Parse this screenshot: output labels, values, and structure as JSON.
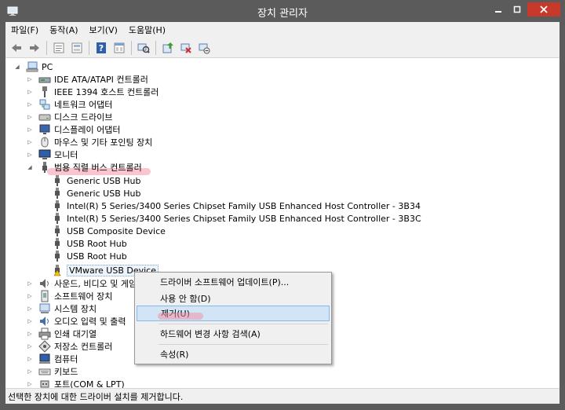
{
  "window": {
    "title": "장치 관리자",
    "accent_color": "#c7392b"
  },
  "menu": {
    "file": "파일(F)",
    "action": "동작(A)",
    "view": "보기(V)",
    "help": "도움말(H)"
  },
  "toolbar": {
    "buttons": [
      "back-arrow-icon",
      "forward-arrow-icon",
      "properties-icon",
      "show-hide-icon",
      "help-icon",
      "view-icon",
      "scan-hardware-icon",
      "update-driver-icon",
      "uninstall-icon",
      "disable-icon"
    ]
  },
  "tree": {
    "root": "PC",
    "items": {
      "ide": "IDE ATA/ATAPI 컨트롤러",
      "ieee1394": "IEEE 1394 호스트 컨트롤러",
      "network": "네트워크 어댑터",
      "disk": "디스크 드라이브",
      "display": "디스플레이 어댑터",
      "mouse": "마우스 및 기타 포인팅 장치",
      "monitor": "모니터",
      "usb": "범용 직렬 버스 컨트롤러",
      "sound": "사운드, 비디오 및 게임",
      "software": "소프트웨어 장치",
      "system": "시스템 장치",
      "audio_io": "오디오 입력 및 출력",
      "print_queue": "인쇄 대기열",
      "storage": "저장소 컨트롤러",
      "computer": "컴퓨터",
      "keyboard": "키보드",
      "ports": "포트(COM & LPT)"
    },
    "usb_children": [
      "Generic USB Hub",
      "Generic USB Hub",
      "Intel(R) 5 Series/3400 Series Chipset Family USB Enhanced Host Controller - 3B34",
      "Intel(R) 5 Series/3400 Series Chipset Family USB Enhanced Host Controller - 3B3C",
      "USB Composite Device",
      "USB Root Hub",
      "USB Root Hub",
      "VMware USB Device"
    ]
  },
  "context_menu": {
    "update_driver": "드라이버 소프트웨어 업데이트(P)...",
    "disable": "사용 안 함(D)",
    "uninstall": "제거(U)",
    "scan": "하드웨어 변경 사항 검색(A)",
    "properties": "속성(R)"
  },
  "status": {
    "text": "선택한 장치에 대한 드라이버 설치를 제거합니다."
  }
}
